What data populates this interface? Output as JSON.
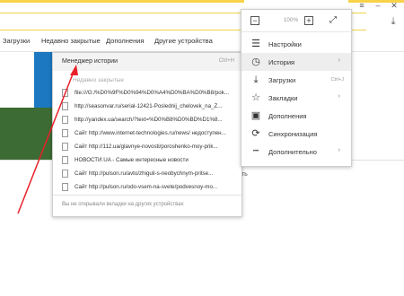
{
  "browser": {
    "bookmarks_bar": [
      "Загрузки",
      "Недавно закрытые",
      "Дополнения",
      "Другие устройства"
    ]
  },
  "page": {
    "partial_link": "ить"
  },
  "history_menu": {
    "manager_label": "Менеджер истории",
    "manager_shortcut": "Ctrl+H",
    "recent_heading": "Недавно закрытые",
    "items": [
      "file:///G:/%D0%9F%D0%94%D0%A4%D0%BA%D0%B8/pok...",
      "http://seasonvar.ru/serial-12421-Poslednij_chelovek_na_Z...",
      "http://yandex.ua/search/?text=%D0%B8%D0%BD%D1%8...",
      "Сайт http://www.internet-technologies.ru/news/ недоступен...",
      "Сайт http://112.ua/glavnye-novosti/poroshenko-moy-prik...",
      "НОВОСТИ.UA - Самые интересные новости",
      "Сайт http://pulson.ru/avto/zhiguli-s-neobychnym-pritse...",
      "Сайт http://pulson.ru/odo-vsem-na-svete/podvesnoy-mo..."
    ],
    "footer": "Вы не открывали вкладки на других устройствах"
  },
  "main_menu": {
    "zoom": {
      "minus": "−",
      "value": "100%",
      "plus": "+"
    },
    "items": [
      {
        "label": "Настройки",
        "icon": "settings-sliders-icon",
        "glyph": "☰",
        "arrow": "",
        "shortcut": ""
      },
      {
        "label": "История",
        "icon": "clock-icon",
        "glyph": "◷",
        "arrow": "›",
        "shortcut": ""
      },
      {
        "label": "Загрузки",
        "icon": "download-icon",
        "glyph": "⤓",
        "arrow": "",
        "shortcut": "Ctrl+J"
      },
      {
        "label": "Закладки",
        "icon": "star-icon",
        "glyph": "☆",
        "arrow": "›",
        "shortcut": ""
      },
      {
        "label": "Дополнения",
        "icon": "extensions-icon",
        "glyph": "▣",
        "arrow": "",
        "shortcut": ""
      },
      {
        "label": "Синхронизация",
        "icon": "sync-icon",
        "glyph": "⟳",
        "arrow": "",
        "shortcut": ""
      },
      {
        "label": "Дополнительно",
        "icon": "more-dots-icon",
        "glyph": "•••",
        "arrow": "›",
        "shortcut": ""
      }
    ]
  },
  "colors": {
    "accent_yellow": "#f7d34a",
    "arrow_red": "#e8202a"
  }
}
